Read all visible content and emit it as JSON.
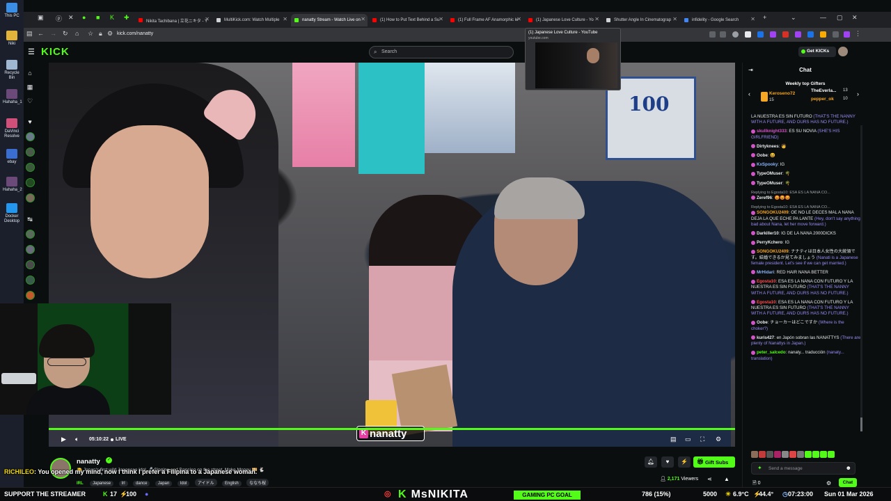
{
  "desktop": {
    "items": [
      {
        "label": "This PC",
        "color": "#3a8ee6"
      },
      {
        "label": "Niki",
        "color": "#e0b43a"
      },
      {
        "label": "Recycle Bin",
        "color": "#9fb7d1"
      },
      {
        "label": "Hahaha_1",
        "color": "#6b4a7a"
      },
      {
        "label": "DaVinci Resolve",
        "color": "#d0507a"
      },
      {
        "label": "ebay",
        "color": "#3a6fd1"
      },
      {
        "label": "Hahaha_2",
        "color": "#6b4a7a"
      },
      {
        "label": "Docker Desktop",
        "color": "#2496ed"
      }
    ]
  },
  "browser": {
    "tabs": [
      {
        "label": "Nikita Tachibana | 立花ニキタ - Y",
        "fav": "#ff0000"
      },
      {
        "label": "MultiKick.com: Watch Multiple",
        "fav": "#cfd2d6"
      },
      {
        "label": "nanatty Stream - Watch Live on",
        "fav": "#53fc18",
        "active": true
      },
      {
        "label": "(1) How to Put Text Behind a Su",
        "fav": "#ff0000"
      },
      {
        "label": "(1) Full Frame AF Anamorphic le",
        "fav": "#ff0000"
      },
      {
        "label": "(1) Japanese Love Culture - Yo",
        "fav": "#ff0000"
      },
      {
        "label": "Shutter Angle In Cinematograp",
        "fav": "#cfd2d6"
      },
      {
        "label": "infidelity - Google Search",
        "fav": "#4285f4"
      }
    ],
    "url": "kick.com/nanatty",
    "tooltip": {
      "title": "(1) Japanese Love Culture - YouTube",
      "domain": "youtube.com"
    }
  },
  "kick": {
    "logo": "KICK",
    "search_placeholder": "Search",
    "get_kicks": "Get KICKs"
  },
  "video": {
    "time": "05:10:22",
    "live": "LIVE",
    "overlay_name": "nanatty",
    "overlay_k": "K"
  },
  "channel": {
    "name": "nanatty",
    "subtitle": "🍋 Japan's first wild Japanese Idol 🎤 Singing and Dancing on the street. Make Money 💴 🐇",
    "category": "IRL",
    "tags": [
      "Japanese",
      "Irl",
      "dance",
      "Japan",
      "Idol",
      "アイドル",
      "English",
      "ななち桜"
    ],
    "gift_subs": "Gift Subs",
    "viewers_count": "2,171",
    "viewers_label": "Viewers"
  },
  "overlay_message": {
    "user": "RICHILEO",
    "text": ": You opened my mind, now I think I prefer a Filipina to a Japanese woman."
  },
  "ticker": {
    "support": "SUPPORT THE STREAMER",
    "k_count": "17",
    "k_total": "100",
    "brand_k": "K",
    "brand": "MsNIKITA",
    "goal_label": "GAMING PC GOAL",
    "goal_progress": "786 (15%)",
    "goal_target": "5000",
    "temp": "6.9°C",
    "humidity": "44.4°",
    "clock": "07:23:00",
    "date": "Sun 01 Mar 2026"
  },
  "chat": {
    "title": "Chat",
    "weekly_title": "Weekly top Gifters",
    "gifters": [
      {
        "name": "Keroseno72",
        "count": "15"
      },
      {
        "name": "TheEverla...",
        "count": "13"
      },
      {
        "name": "pepper_ok",
        "count": "10"
      }
    ],
    "messages": [
      {
        "user": "",
        "color": "#e8eaed",
        "text": "LA NUESTRA ES SIN FUTURO",
        "tr": "(THAT'S THE NANNY WITH A FUTURE, AND OURS HAS NO FUTURE.)"
      },
      {
        "user": "skullknight333",
        "color": "#d155c7",
        "text": ": ES SU NOVIA",
        "tr": "(SHE'S HIS GIRLFRIEND)"
      },
      {
        "user": "Dirtyknees",
        "color": "#e8eaed",
        "text": ": 🧑",
        "tr": ""
      },
      {
        "user": "Oobe",
        "color": "#e8eaed",
        "text": ": 😆",
        "tr": ""
      },
      {
        "user": "KxSpooky",
        "color": "#8ab4f8",
        "text": ": IG",
        "tr": ""
      },
      {
        "user": "TypeOMuser",
        "color": "#e8eaed",
        "text": ": 🌴",
        "tr": ""
      },
      {
        "user": "TypeOMuser",
        "color": "#e8eaed",
        "text": ": 🌴",
        "tr": ""
      },
      {
        "user": "Zeref96",
        "color": "#e8eaed",
        "text": ": 😡😡😡",
        "tr": "",
        "reply": "Replying to Egosta10: ESA ES LA NANA CO..."
      },
      {
        "user": "SONGOKU2409",
        "color": "#f5a623",
        "text": ": OE NO LE DECES MAL A NANA DEJA LA QUE ECHE PA LANTE",
        "tr": "(Hey, don't say anything bad about Nana, let her move forward.)",
        "reply": "Replying to Egosta10: ESA ES LA NANA CO..."
      },
      {
        "user": "Darkiller10",
        "color": "#e8eaed",
        "text": ": IG DE LA NANA 2000DICKS",
        "tr": ""
      },
      {
        "user": "PerryKchero",
        "color": "#e8eaed",
        "text": ": IG",
        "tr": ""
      },
      {
        "user": "SONGOKU2409",
        "color": "#f5a623",
        "text": ": ナナティは日本人女性の大統領です。結婚できるか見てみましょう",
        "tr": "(Nanati is a Japanese female president. Let's see if we can get married.)"
      },
      {
        "user": "MrHidari",
        "color": "#8ab4f8",
        "text": ": RED HAIR NANA BETTER",
        "tr": ""
      },
      {
        "user": "Egosta10",
        "color": "#ff4d4d",
        "text": ": ESA ES LA NANA CON FUTURO Y LA NUESTRA ES SIN FUTURO",
        "tr": "(THAT'S THE NANNY WITH A FUTURE, AND OURS HAS NO FUTURE.)"
      },
      {
        "user": "Egosta10",
        "color": "#ff4d4d",
        "text": ": ESA ES LA NANA CON FUTURO Y LA NUESTRA ES SIN FUTURO",
        "tr": "(THAT'S THE NANNY WITH A FUTURE, AND OURS HAS NO FUTURE.)"
      },
      {
        "user": "Oobe",
        "color": "#e8eaed",
        "text": ": チョーカーはどこですか",
        "tr": "(Where is the choker?)"
      },
      {
        "user": "kuris427",
        "color": "#e8eaed",
        "text": ": en Japón sobran las NANATTYS",
        "tr": "(There are plenty of Nanattys in Japan.)"
      },
      {
        "user": "peter_salcedo",
        "color": "#53fc18",
        "text": ": nanaty... traducción",
        "tr": "(nanaty... translation)"
      }
    ],
    "input_placeholder": "Send a message",
    "points": "0",
    "send": "Chat"
  }
}
